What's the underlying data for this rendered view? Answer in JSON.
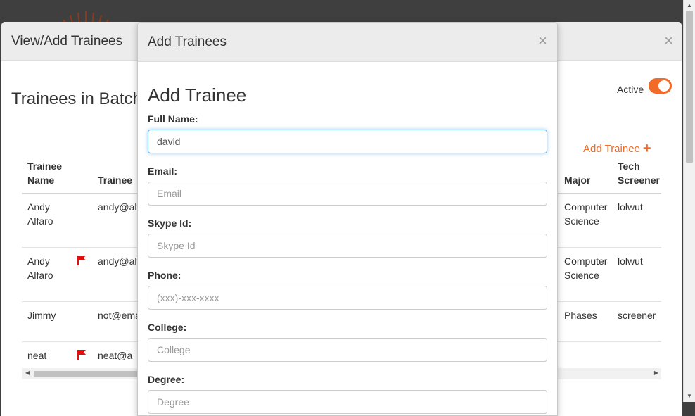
{
  "outer_modal": {
    "title": "View/Add Trainees",
    "close_label": "×",
    "batch_heading": "Trainees in Batch",
    "active_label": "Active",
    "active_on": true,
    "add_trainee_label": "Add Trainee",
    "add_trainee_icon": "+",
    "columns": [
      "Trainee Name",
      "Trainee",
      "Major",
      "Tech Screener"
    ],
    "rows": [
      {
        "name": "Andy Alfaro",
        "flag": false,
        "email": "andy@alf",
        "major": "Computer Science",
        "screener": "lolwut"
      },
      {
        "name": "Andy Alfaro",
        "flag": true,
        "email": "andy@alf",
        "major": "Computer Science",
        "screener": "lolwut"
      },
      {
        "name": "Jimmy",
        "flag": false,
        "email": "not@ema",
        "major": "Phases",
        "screener": "screener"
      },
      {
        "name": "neat",
        "flag": true,
        "email": "neat@a",
        "major": "",
        "screener": ""
      }
    ]
  },
  "inner_modal": {
    "title": "Add Trainees",
    "close_label": "×",
    "form_heading": "Add Trainee",
    "fields": {
      "full_name": {
        "label": "Full Name:",
        "value": "david",
        "placeholder": ""
      },
      "email": {
        "label": "Email:",
        "value": "",
        "placeholder": "Email"
      },
      "skype": {
        "label": "Skype Id:",
        "value": "",
        "placeholder": "Skype Id"
      },
      "phone": {
        "label": "Phone:",
        "value": "",
        "placeholder": "(xxx)-xxx-xxxx"
      },
      "college": {
        "label": "College:",
        "value": "",
        "placeholder": "College"
      },
      "degree": {
        "label": "Degree:",
        "value": "",
        "placeholder": "Degree"
      }
    }
  },
  "colors": {
    "accent": "#f26a28",
    "flag": "#e01010",
    "backdrop": "#3f3f3f",
    "header_bg": "#ececec",
    "focus": "#66afe9"
  }
}
